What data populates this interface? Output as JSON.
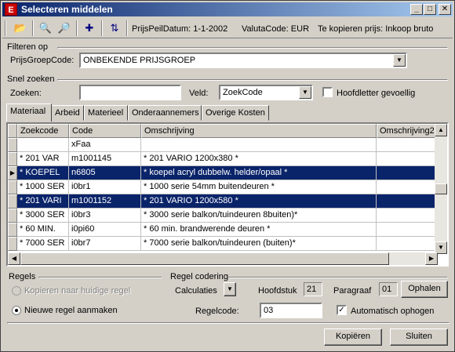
{
  "window": {
    "title": "Selecteren middelen"
  },
  "toolbar": {
    "prijspeil": "PrijsPeilDatum: 1-1-2002",
    "valuta": "ValutaCode: EUR",
    "kopieren_prijs": "Te kopieren prijs: Inkoop bruto"
  },
  "filter": {
    "section": "Filteren op",
    "prijsgroep_label": "PrijsGroepCode:",
    "prijsgroep_value": "ONBEKENDE PRIJSGROEP"
  },
  "search": {
    "section": "Snel zoeken",
    "zoeken_label": "Zoeken:",
    "zoeken_value": "",
    "veld_label": "Veld:",
    "veld_value": "ZoekCode",
    "hoofdletter_label": "Hoofdletter gevoellig"
  },
  "tabs": [
    {
      "label": "Materiaal"
    },
    {
      "label": "Arbeid"
    },
    {
      "label": "Materieel"
    },
    {
      "label": "Onderaannemers"
    },
    {
      "label": "Overige Kosten"
    }
  ],
  "grid": {
    "columns": [
      "Zoekcode",
      "Code",
      "Omschrijving",
      "Omschrijving2"
    ],
    "rows": [
      {
        "zoekcode": "",
        "code": "xFaa",
        "omschrijving": "",
        "omschrijving2": ""
      },
      {
        "zoekcode": "* 201 VAR",
        "code": "m1001145",
        "omschrijving": "* 201 VARIO 1200x380 *",
        "omschrijving2": ""
      },
      {
        "zoekcode": "* KOEPEL",
        "code": "n6805",
        "omschrijving": "* koepel acryl dubbelw. helder/opaal *",
        "omschrijving2": ""
      },
      {
        "zoekcode": "* 1000 SER",
        "code": "i0br1",
        "omschrijving": "* 1000 serie 54mm buitendeuren *",
        "omschrijving2": ""
      },
      {
        "zoekcode": "* 201 VARI",
        "code": "m1001152",
        "omschrijving": "* 201 VARIO 1200x580 *",
        "omschrijving2": ""
      },
      {
        "zoekcode": "* 3000 SER",
        "code": "i0br3",
        "omschrijving": "* 3000 serie balkon/tuindeuren 8buiten)*",
        "omschrijving2": ""
      },
      {
        "zoekcode": "* 60 MIN.",
        "code": "i0pi60",
        "omschrijving": "* 60 min. brandwerende deuren *",
        "omschrijving2": ""
      },
      {
        "zoekcode": "* 7000 SER",
        "code": "i0br7",
        "omschrijving": "* 7000 serie balkon/tuindeuren (buiten)*",
        "omschrijving2": ""
      }
    ]
  },
  "regels": {
    "section": "Regels",
    "kopieren_label": "Kopieren naar huidige regel",
    "nieuwe_label": "Nieuwe regel aanmaken"
  },
  "codering": {
    "section": "Regel codering",
    "calculaties_label": "Calculaties",
    "hoofdstuk_label": "Hoofdstuk",
    "hoofdstuk_value": "21",
    "paragraaf_label": "Paragraaf",
    "paragraaf_value": "01",
    "ophalen_label": "Ophalen",
    "regelcode_label": "Regelcode:",
    "regelcode_value": "03",
    "auto_label": "Automatisch ophogen"
  },
  "buttons": {
    "kopieren": "Kopiëren",
    "sluiten": "Sluiten"
  }
}
